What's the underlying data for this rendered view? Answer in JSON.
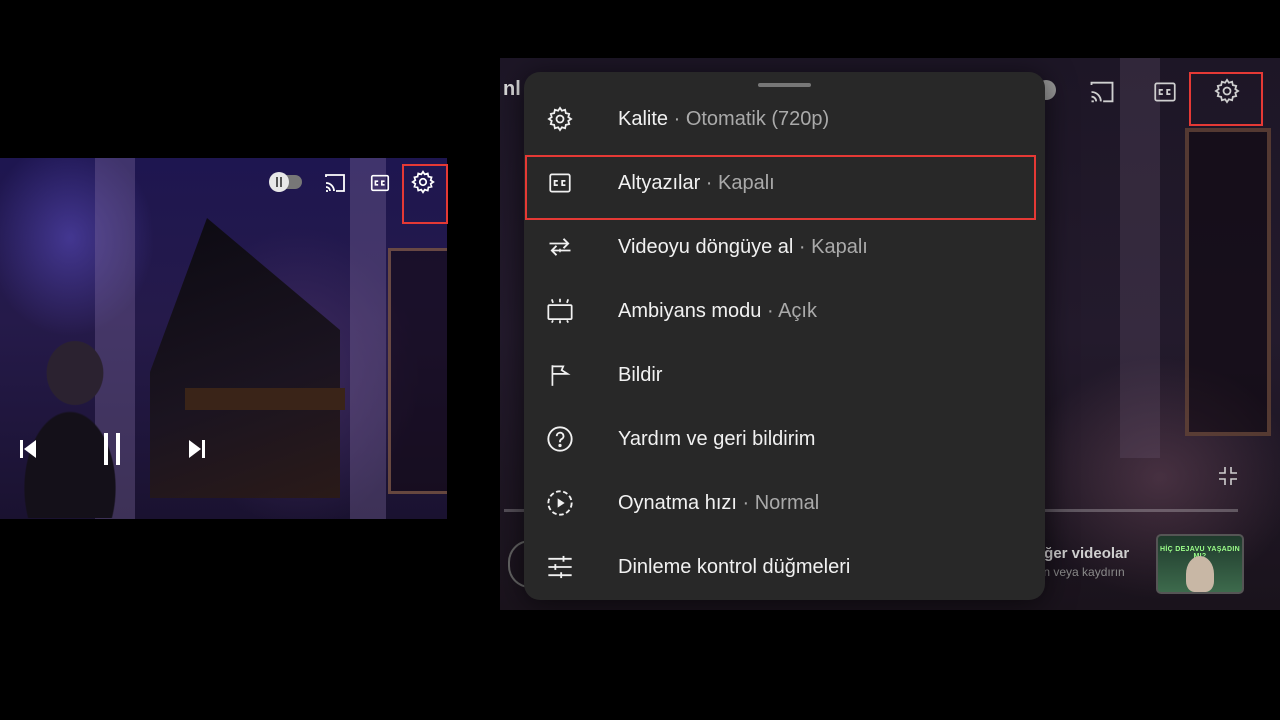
{
  "left_player": {
    "controls": [
      "toggle",
      "cast-icon",
      "cc-icon",
      "gear-icon",
      "previous-icon",
      "pause-icon",
      "next-icon"
    ]
  },
  "right_player": {
    "title_stub": "nl",
    "more_videos": {
      "title": "iğer videolar",
      "subtitle": "ın veya kaydırın"
    },
    "thumbnail_text": "HİÇ DEJAVU YAŞADIN MI?"
  },
  "settings_menu": {
    "items": [
      {
        "icon": "gear-icon",
        "label": "Kalite",
        "value": "Otomatik (720p)"
      },
      {
        "icon": "cc-icon",
        "label": "Altyazılar",
        "value": "Kapalı"
      },
      {
        "icon": "loop-icon",
        "label": "Videoyu döngüye al",
        "value": "Kapalı"
      },
      {
        "icon": "ambient-icon",
        "label": "Ambiyans modu",
        "value": "Açık"
      },
      {
        "icon": "flag-icon",
        "label": "Bildir",
        "value": ""
      },
      {
        "icon": "help-icon",
        "label": "Yardım ve geri bildirim",
        "value": ""
      },
      {
        "icon": "playback-speed-icon",
        "label": "Oynatma hızı",
        "value": "Normal"
      },
      {
        "icon": "sliders-icon",
        "label": "Dinleme kontrol düğmeleri",
        "value": ""
      }
    ],
    "separator": " · "
  },
  "colors": {
    "highlight": "#e53935",
    "sheet_bg": "#282828",
    "value_text": "#aaaaaa"
  }
}
